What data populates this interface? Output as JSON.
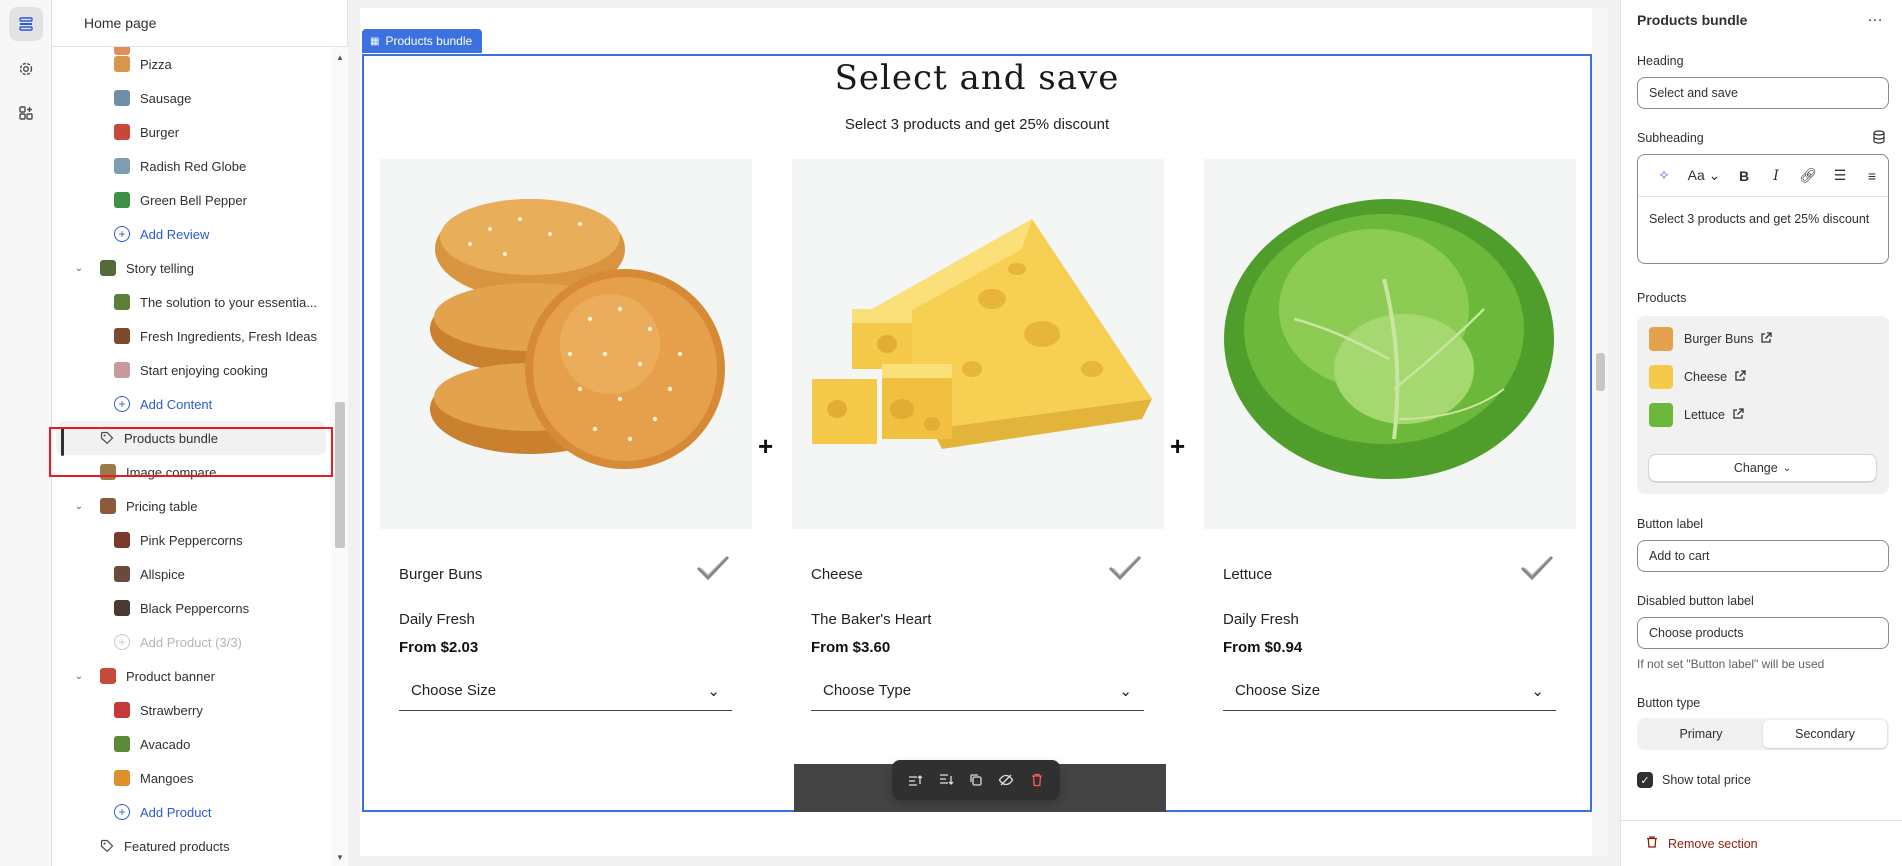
{
  "left_panel": {
    "title": "Home page",
    "items": [
      {
        "label": "Pizza",
        "kind": "child",
        "color": "#d9954a"
      },
      {
        "label": "Sausage",
        "kind": "child",
        "color": "#6f8fa6"
      },
      {
        "label": "Burger",
        "kind": "child",
        "color": "#c8473a"
      },
      {
        "label": "Radish Red Globe",
        "kind": "child",
        "color": "#7b9fb0"
      },
      {
        "label": "Green Bell Pepper",
        "kind": "child",
        "color": "#3f8f46"
      },
      {
        "label": "Add Review",
        "kind": "add"
      },
      {
        "label": "Story telling",
        "kind": "section",
        "color": "#556b3b"
      },
      {
        "label": "The solution to your essentia...",
        "kind": "child",
        "color": "#5c7f3a"
      },
      {
        "label": "Fresh Ingredients, Fresh Ideas",
        "kind": "child",
        "color": "#7a4a2e"
      },
      {
        "label": "Start enjoying cooking",
        "kind": "child",
        "color": "#c99a9a"
      },
      {
        "label": "Add Content",
        "kind": "add"
      },
      {
        "label": "Products bundle",
        "kind": "selected"
      },
      {
        "label": "Image compare",
        "kind": "plain",
        "color": "#9c7a4a"
      },
      {
        "label": "Pricing table",
        "kind": "section",
        "color": "#8a5a3a"
      },
      {
        "label": "Pink Peppercorns",
        "kind": "child",
        "color": "#7a3a2a"
      },
      {
        "label": "Allspice",
        "kind": "child",
        "color": "#6a4a3a"
      },
      {
        "label": "Black Peppercorns",
        "kind": "child",
        "color": "#4a3a30"
      },
      {
        "label": "Add Product (3/3)",
        "kind": "disabled"
      },
      {
        "label": "Product banner",
        "kind": "section",
        "color": "#c44a3a"
      },
      {
        "label": "Strawberry",
        "kind": "child",
        "color": "#c43a3a"
      },
      {
        "label": "Avacado",
        "kind": "child",
        "color": "#5a8a3a"
      },
      {
        "label": "Mangoes",
        "kind": "child",
        "color": "#e0902a"
      },
      {
        "label": "Add Product",
        "kind": "add"
      },
      {
        "label": "Featured products",
        "kind": "plain-tag"
      }
    ]
  },
  "preview": {
    "tag": "Products bundle",
    "heading": "Select and save",
    "subheading": "Select 3 products and get 25% discount",
    "products": [
      {
        "name": "Burger Buns",
        "vendor": "Daily Fresh",
        "price": "From $2.03",
        "select": "Choose Size"
      },
      {
        "name": "Cheese",
        "vendor": "The Baker's Heart",
        "price": "From $3.60",
        "select": "Choose Type"
      },
      {
        "name": "Lettuce",
        "vendor": "Daily Fresh",
        "price": "From $0.94",
        "select": "Choose Size"
      }
    ],
    "plus": "+"
  },
  "settings": {
    "title": "Products bundle",
    "more": "…",
    "heading_label": "Heading",
    "heading_value": "Select and save",
    "subheading_label": "Subheading",
    "subheading_value": "Select 3 products and get 25% discount",
    "products_label": "Products",
    "products": [
      {
        "name": "Burger Buns"
      },
      {
        "name": "Cheese"
      },
      {
        "name": "Lettuce"
      }
    ],
    "change_label": "Change",
    "button_label_label": "Button label",
    "button_label_value": "Add to cart",
    "disabled_label_label": "Disabled button label",
    "disabled_label_value": "Choose products",
    "help_text": "If not set \"Button label\" will be used",
    "button_type_label": "Button type",
    "button_type_options": [
      "Primary",
      "Secondary"
    ],
    "button_type_selected": "Secondary",
    "show_total_label": "Show total price",
    "show_total_checked": true,
    "remove_label": "Remove section"
  },
  "colors": {
    "accent": "#3b72e0",
    "link": "#2c5ad6",
    "danger": "#8e1f0b",
    "highlight": "#e51c23"
  }
}
